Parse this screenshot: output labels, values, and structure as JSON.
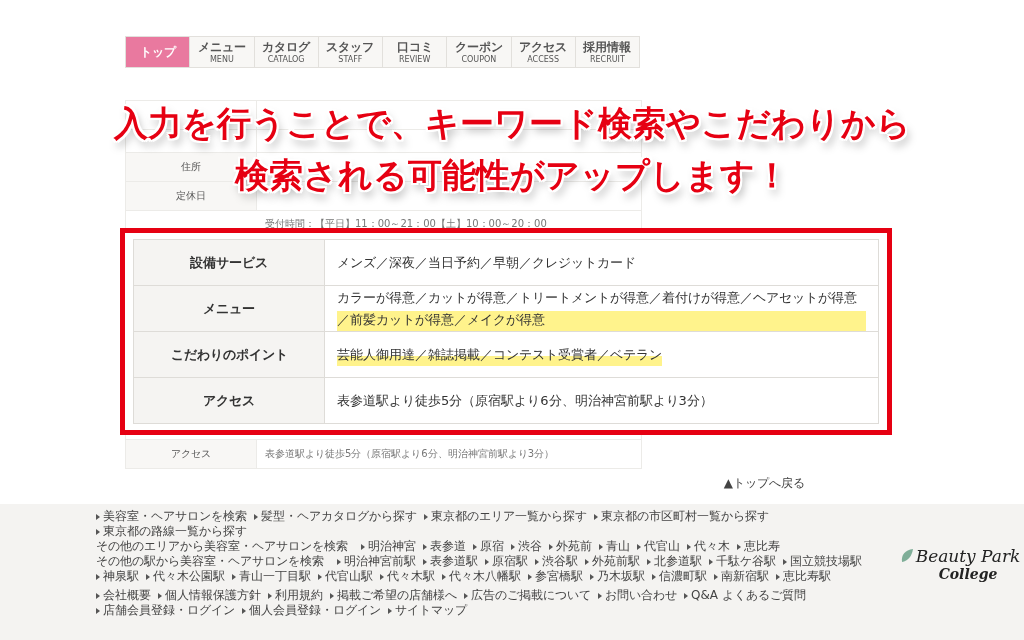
{
  "nav": {
    "tabs": [
      {
        "label": "トップ",
        "selected": true
      },
      {
        "label": "メニュー",
        "sublabel": "MENU",
        "selected": false
      },
      {
        "label": "カタログ",
        "sublabel": "CATALOG",
        "selected": false
      },
      {
        "label": "スタッフ",
        "sublabel": "STAFF",
        "selected": false
      },
      {
        "label": "口コミ",
        "sublabel": "REVIEW",
        "selected": false
      },
      {
        "label": "クーポン",
        "sublabel": "COUPON",
        "selected": false
      },
      {
        "label": "アクセス",
        "sublabel": "ACCESS",
        "selected": false
      },
      {
        "label": "採用情報",
        "sublabel": "RECRUIT",
        "selected": false
      }
    ]
  },
  "info_table": {
    "rows": [
      {
        "label": "住所"
      },
      {
        "label": "定休日"
      },
      {
        "value": "受付時間：【平日】11：00～21：00【土】10：00～20：00"
      },
      {
        "label": "アクセス",
        "value": "表参道駅より徒歩5分（原宿駅より6分、明治神宮前駅より3分）"
      }
    ]
  },
  "headline": [
    "入力を行うことで、キーワード検索やこだわりから",
    "検索される可能性がアップします！"
  ],
  "callout": {
    "rows": [
      {
        "label": "設備サービス",
        "value": "メンズ／深夜／当日予約／早朝／クレジットカード",
        "highlighted": false
      },
      {
        "label": "メニュー",
        "value": "カラーが得意／カットが得意／トリートメントが得意／着付けが得意／ヘアセットが得意／前髪カットが得意／メイクが得意",
        "highlighted": true
      },
      {
        "label": "こだわりのポイント",
        "value": "芸能人御用達／雑誌掲載／コンテスト受賞者／ベテラン",
        "highlighted": true
      },
      {
        "label": "アクセス",
        "value": "表参道駅より徒歩5分（原宿駅より6分、明治神宮前駅より3分）",
        "highlighted": false
      }
    ]
  },
  "back_to_top": "▲トップへ戻る",
  "footer": {
    "search_links": [
      "美容室・ヘアサロンを検索",
      "髪型・ヘアカタログから探す",
      "東京都のエリア一覧から探す",
      "東京都の市区町村一覧から探す",
      "東京都の路線一覧から探す"
    ],
    "area_search": {
      "label": "その他のエリアから美容室・ヘアサロンを検索",
      "links": [
        "明治神宮",
        "表参道",
        "原宿",
        "渋谷",
        "外苑前",
        "青山",
        "代官山",
        "代々木",
        "恵比寿"
      ]
    },
    "station_search": {
      "label": "その他の駅から美容室・ヘアサロンを検索",
      "links": [
        "明治神宮前駅",
        "表参道駅",
        "原宿駅",
        "渋谷駅",
        "外苑前駅",
        "北参道駅",
        "千駄ケ谷駅",
        "国立競技場駅",
        "神泉駅",
        "代々木公園駅",
        "青山一丁目駅",
        "代官山駅",
        "代々木駅",
        "代々木八幡駅",
        "参宮橋駅",
        "乃木坂駅",
        "信濃町駅",
        "南新宿駅",
        "恵比寿駅"
      ]
    },
    "site_links": [
      "会社概要",
      "個人情報保護方針",
      "利用規約",
      "掲載ご希望の店舗様へ",
      "広告のご掲載について",
      "お問い合わせ",
      "Q&A よくあるご質問",
      "店舗会員登録・ログイン",
      "個人会員登録・ログイン",
      "サイトマップ"
    ],
    "logo": {
      "line1": "Beauty Park",
      "line2": "College"
    }
  }
}
